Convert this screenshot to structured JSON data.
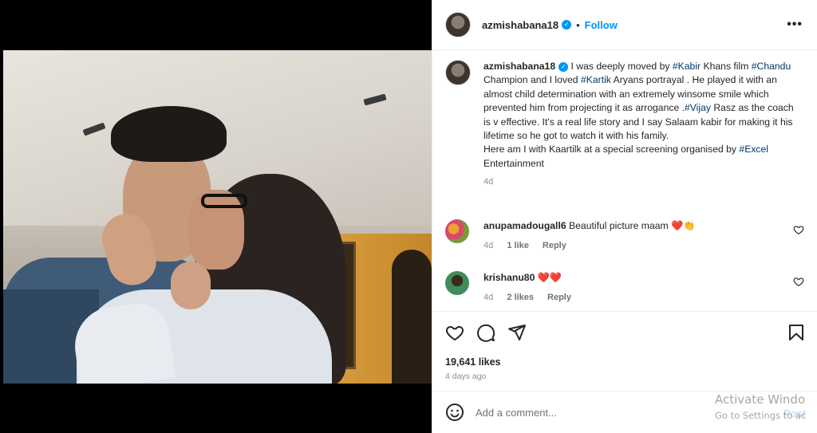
{
  "post": {
    "username": "azmishabana18",
    "verified_mark": "✓",
    "follow_label": "Follow",
    "more_label": "•••",
    "caption": {
      "username": "azmishabana18",
      "t1": " I was deeply moved by ",
      "tag1": "#Kabir",
      "t2": " Khans film ",
      "tag2": "#Chandu",
      "t3": " Champion and I loved ",
      "tag3": "#Kartik",
      "t4": " Aryans portrayal . He played it with an almost child determination with an extremely winsome smile which prevented him from projecting it as arrogance .",
      "tag4": "#Vijay",
      "t5": " Rasz as the coach is v effective. It's a real life story and I say Salaam kabir for making it his lifetime so he got to watch it with his family.",
      "t6": "Here am I with Kaartilk at a special screening organised by ",
      "tag5": "#Excel",
      "t7": " Entertainment",
      "time": "4d"
    },
    "comments": [
      {
        "username": "anupamadougall6",
        "text": " Beautiful picture maam ",
        "emoji": "❤️👏",
        "time": "4d",
        "likes": "1 like",
        "reply": "Reply"
      },
      {
        "username": "krishanu80",
        "text": " ",
        "emoji": "❤️❤️",
        "time": "4d",
        "likes": "2 likes",
        "reply": "Reply"
      }
    ],
    "likes": "19,641 likes",
    "posted": "4 days ago",
    "add_comment_placeholder": "Add a comment...",
    "post_label": "Post"
  },
  "watermark": {
    "line1": "Activate Windo",
    "line2": "Go to Settings to ac"
  },
  "colors": {
    "accent": "#0095f6",
    "tag": "#00376b",
    "heart": "#e02020"
  },
  "icons": [
    "emoji-icon",
    "heart-icon",
    "comment-icon",
    "share-icon",
    "bookmark-icon",
    "more-icon"
  ]
}
